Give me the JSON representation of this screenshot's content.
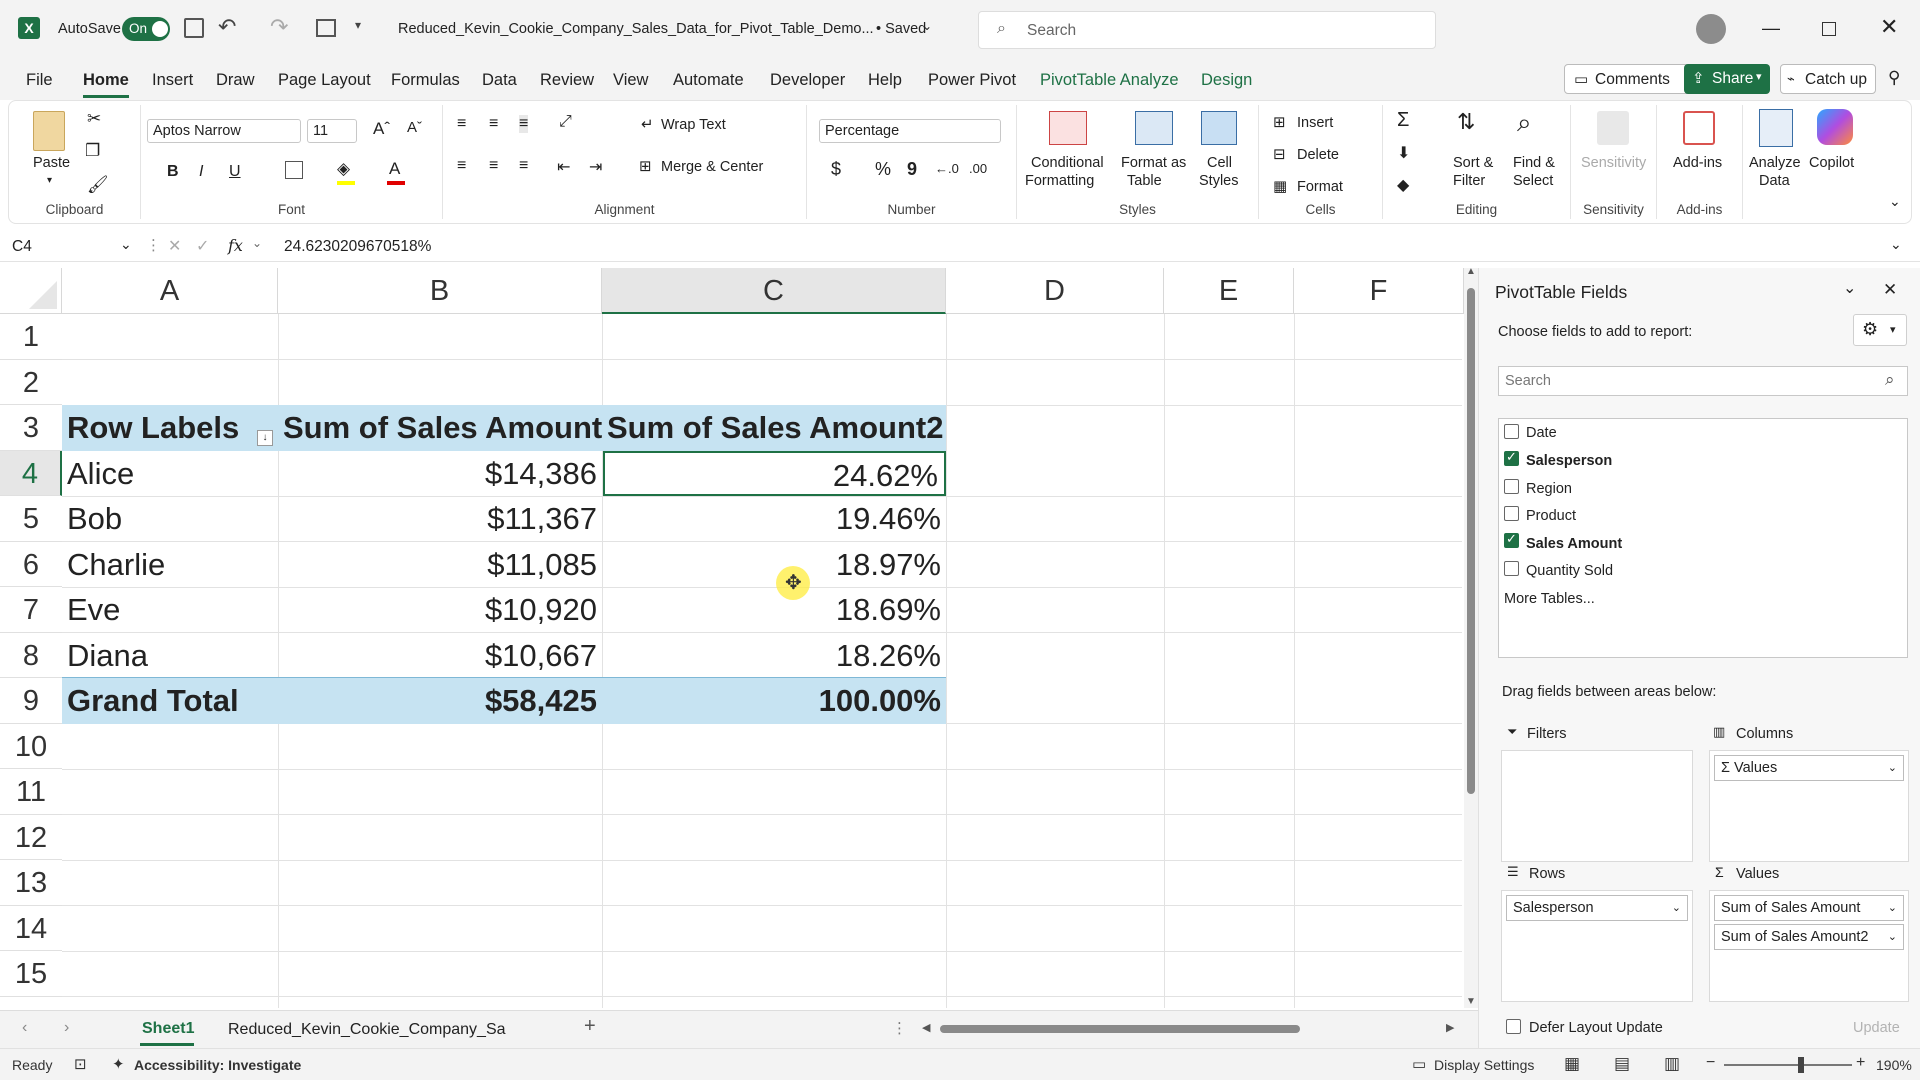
{
  "title_bar": {
    "app_icon": "excel-icon",
    "autosave_label": "AutoSave",
    "autosave_state": "On",
    "file_name": "Reduced_Kevin_Cookie_Company_Sales_Data_for_Pivot_Table_Demo...",
    "saved_status": "• Saved",
    "search_placeholder": "Search"
  },
  "menu_tabs": [
    "File",
    "Home",
    "Insert",
    "Draw",
    "Page Layout",
    "Formulas",
    "Data",
    "Review",
    "View",
    "Automate",
    "Developer",
    "Help",
    "Power Pivot",
    "PivotTable Analyze",
    "Design"
  ],
  "active_tab": "Home",
  "right_buttons": {
    "comments": "Comments",
    "share": "Share",
    "catch_up": "Catch up"
  },
  "ribbon": {
    "clipboard": {
      "paste": "Paste",
      "group": "Clipboard"
    },
    "font": {
      "name": "Aptos Narrow",
      "size": "11",
      "bold": "B",
      "italic": "I",
      "underline": "U",
      "group": "Font"
    },
    "alignment": {
      "wrap": "Wrap Text",
      "merge": "Merge & Center",
      "group": "Alignment"
    },
    "number": {
      "format": "Percentage",
      "currency": "$",
      "percent": "%",
      "comma": "9",
      "group": "Number"
    },
    "styles": {
      "conditional_1": "Conditional",
      "conditional_2": "Formatting",
      "format_table_1": "Format as",
      "format_table_2": "Table",
      "cell_styles_1": "Cell",
      "cell_styles_2": "Styles",
      "group": "Styles"
    },
    "cells": {
      "insert": "Insert",
      "delete": "Delete",
      "format": "Format",
      "group": "Cells"
    },
    "editing": {
      "sort_1": "Sort &",
      "sort_2": "Filter",
      "find_1": "Find &",
      "find_2": "Select",
      "group": "Editing"
    },
    "sensitivity": {
      "label": "Sensitivity",
      "group": "Sensitivity"
    },
    "addins": {
      "label": "Add-ins",
      "group": "Add-ins"
    },
    "analyze": {
      "label_1": "Analyze",
      "label_2": "Data"
    },
    "copilot": {
      "label": "Copilot"
    }
  },
  "formula_bar": {
    "name_box": "C4",
    "fx": "fx",
    "formula": "24.6230209670518%"
  },
  "sheet": {
    "columns": [
      "A",
      "B",
      "C",
      "D",
      "E",
      "F"
    ],
    "rows": [
      "1",
      "2",
      "3",
      "4",
      "5",
      "6",
      "7",
      "8",
      "9",
      "10",
      "11",
      "12",
      "13",
      "14",
      "15"
    ],
    "pivot_header": [
      "Row Labels",
      "Sum of Sales Amount",
      "Sum of Sales Amount2"
    ],
    "pivot_rows": [
      {
        "label": "Alice",
        "amount": "$14,386",
        "pct": "24.62%"
      },
      {
        "label": "Bob",
        "amount": "$11,367",
        "pct": "19.46%"
      },
      {
        "label": "Charlie",
        "amount": "$11,085",
        "pct": "18.97%"
      },
      {
        "label": "Eve",
        "amount": "$10,920",
        "pct": "18.69%"
      },
      {
        "label": "Diana",
        "amount": "$10,667",
        "pct": "18.26%"
      }
    ],
    "grand_total": {
      "label": "Grand Total",
      "amount": "$58,425",
      "pct": "100.00%"
    },
    "header_fill": "#c6e3f2"
  },
  "pivot_pane": {
    "title": "PivotTable Fields",
    "choose_label": "Choose fields to add to report:",
    "search_placeholder": "Search",
    "fields": [
      {
        "name": "Date",
        "checked": false
      },
      {
        "name": "Salesperson",
        "checked": true
      },
      {
        "name": "Region",
        "checked": false
      },
      {
        "name": "Product",
        "checked": false
      },
      {
        "name": "Sales Amount",
        "checked": true
      },
      {
        "name": "Quantity Sold",
        "checked": false
      }
    ],
    "more_tables": "More Tables...",
    "drag_label": "Drag fields between areas below:",
    "filters_label": "Filters",
    "columns_label": "Columns",
    "columns_value": "Σ Values",
    "rows_label": "Rows",
    "rows_value": "Salesperson",
    "values_label": "Values",
    "values_items": [
      "Sum of Sales Amount",
      "Sum of Sales Amount2"
    ],
    "defer_label": "Defer Layout Update",
    "update_label": "Update"
  },
  "sheet_tabs": {
    "active": "Sheet1",
    "other": "Reduced_Kevin_Cookie_Company_Sa"
  },
  "status_bar": {
    "ready": "Ready",
    "accessibility": "Accessibility: Investigate",
    "display_settings": "Display Settings",
    "zoom": "190%"
  },
  "colors": {
    "excel_green": "#1e7145",
    "accent_text": "#1e7145",
    "pivot_fill": "#c6e3f2"
  }
}
